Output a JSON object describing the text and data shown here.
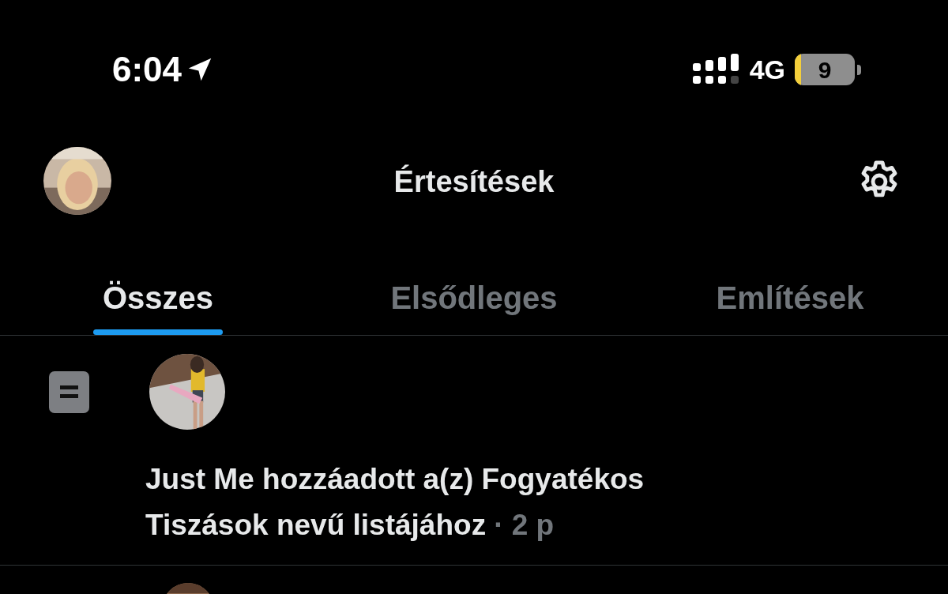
{
  "status_bar": {
    "time": "6:04",
    "network": "4G",
    "battery": "9"
  },
  "header": {
    "title": "Értesítések"
  },
  "tabs": [
    {
      "label": "Összes",
      "selected": true
    },
    {
      "label": "Elsődleges",
      "selected": false
    },
    {
      "label": "Említések",
      "selected": false
    }
  ],
  "notifications": [
    {
      "kind": "list_added",
      "lines": [
        "Just Me hozzáadott a(z) Fogyatékos",
        "Tiszások nevű listájához"
      ],
      "time": "· 2 p"
    },
    {
      "kind": "cut_off"
    }
  ]
}
